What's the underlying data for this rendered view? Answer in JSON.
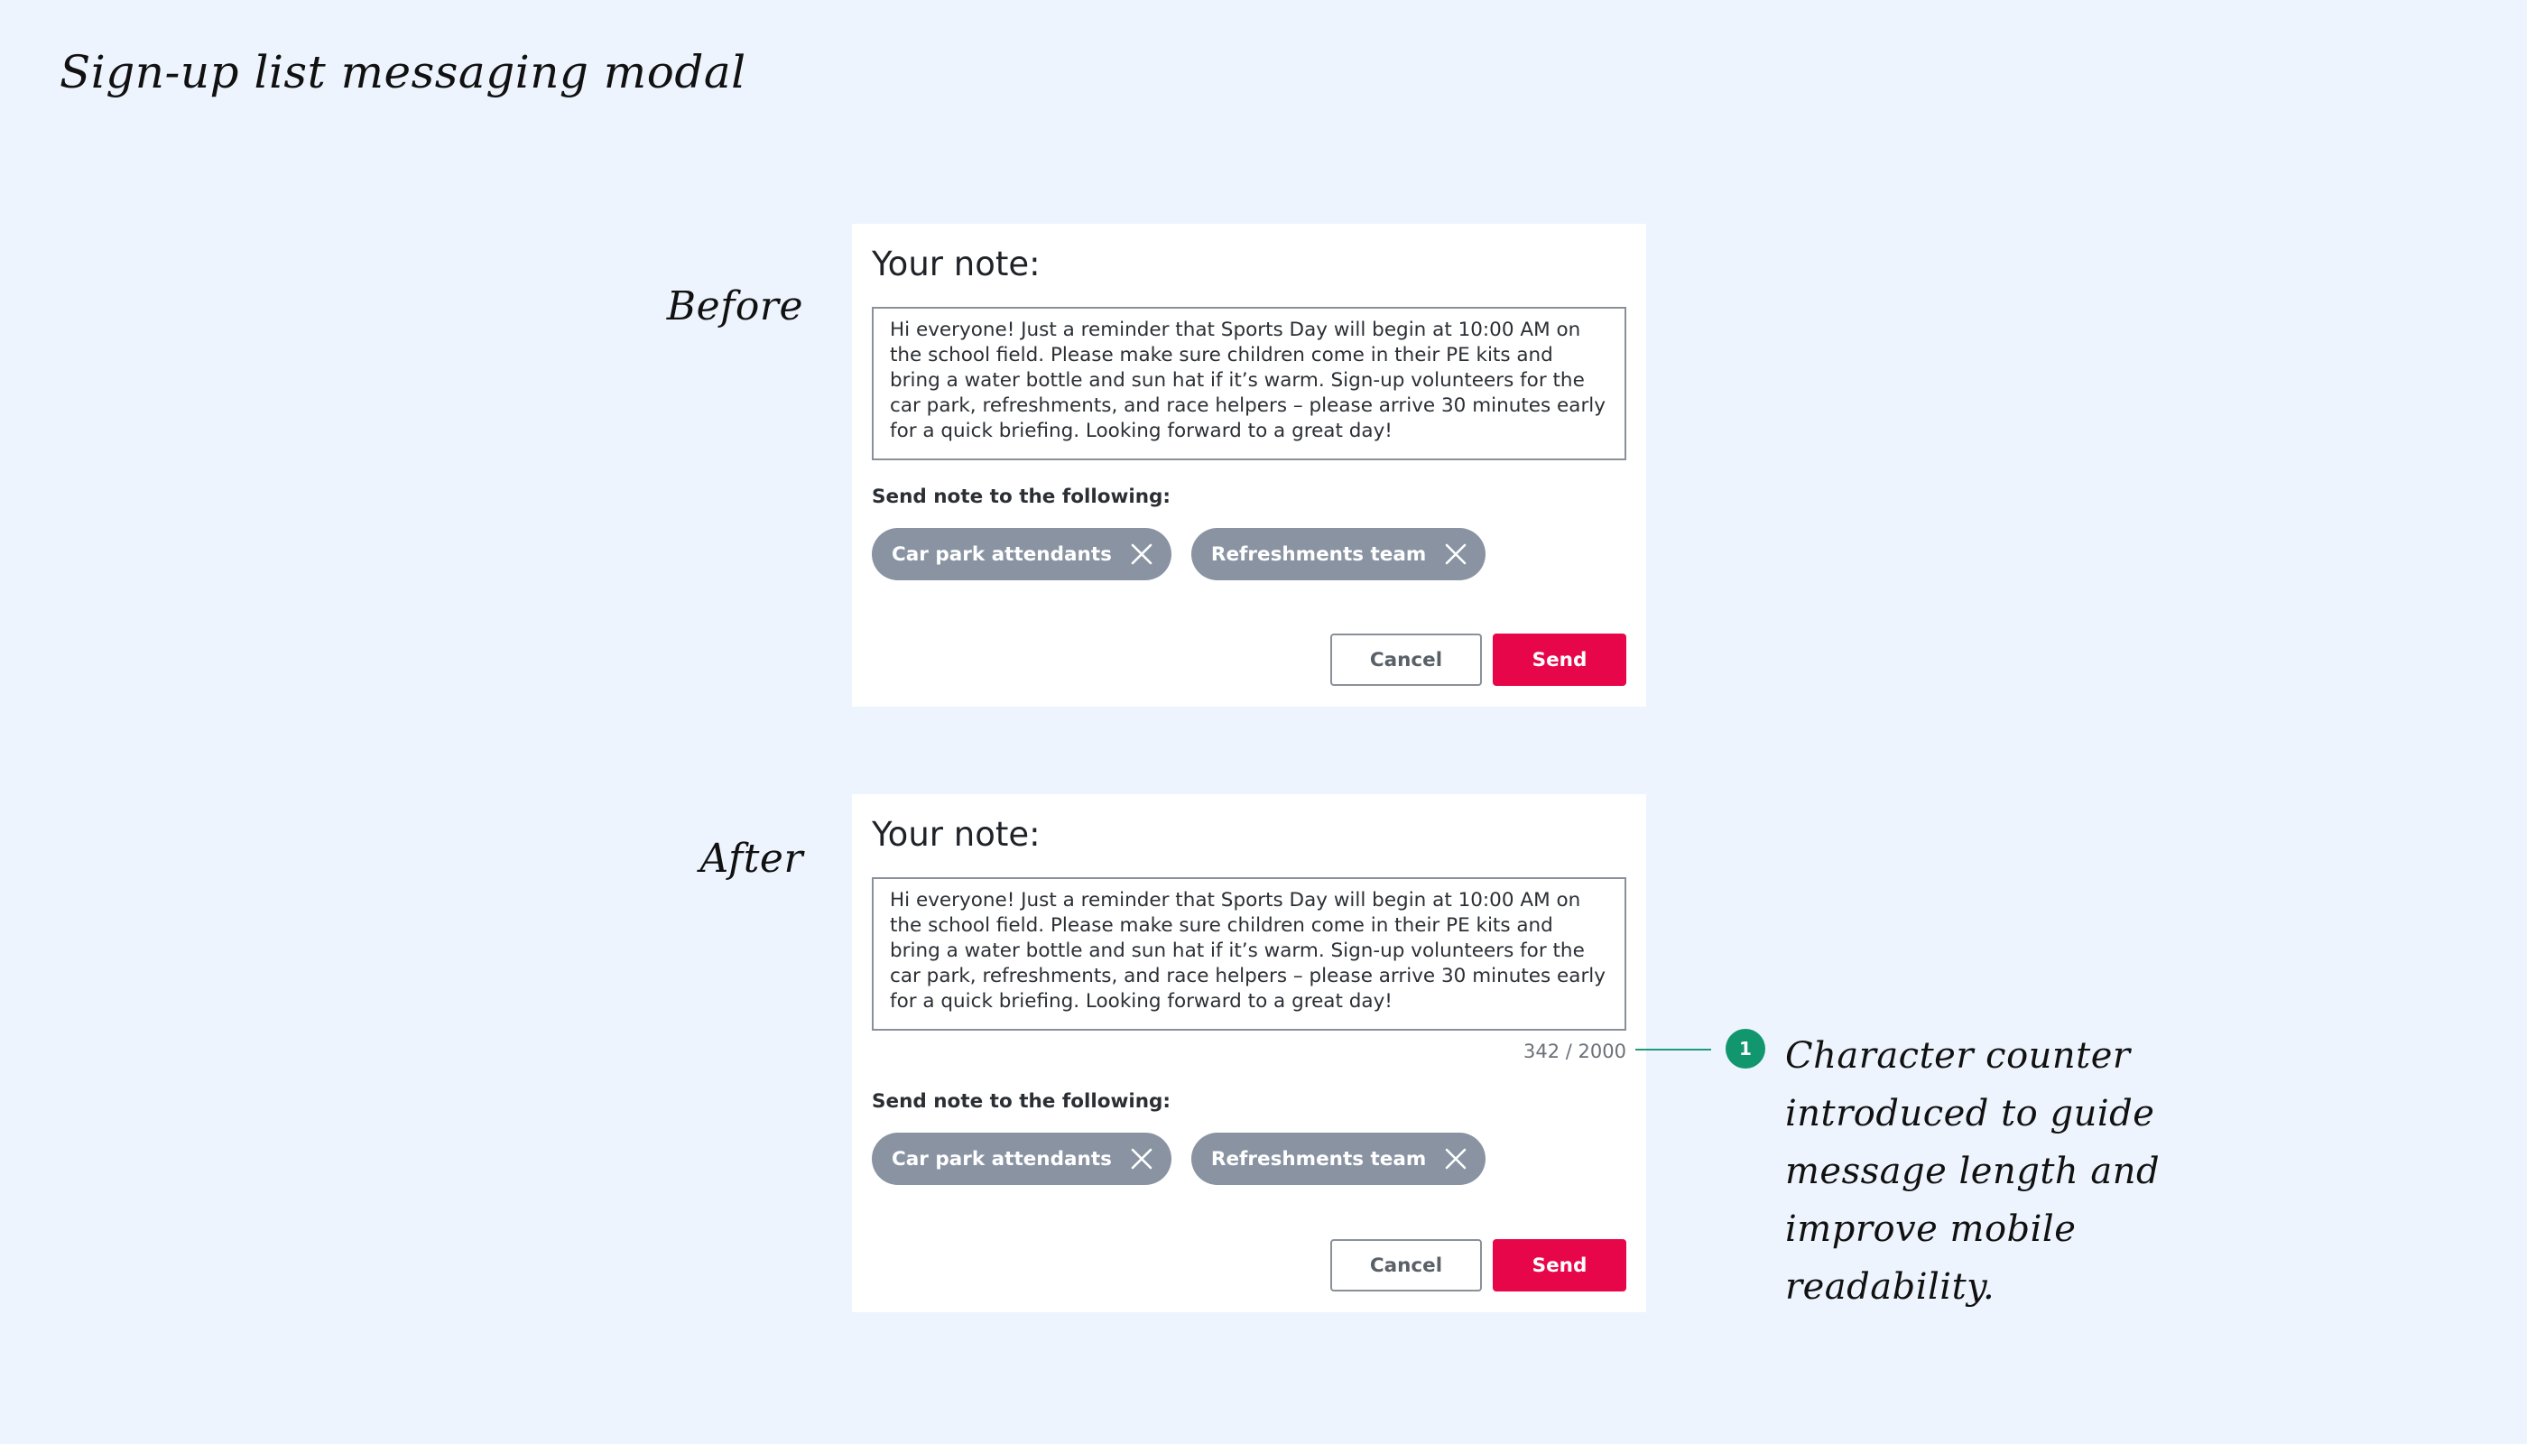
{
  "page": {
    "title": "Sign-up list messaging modal",
    "label_before": "Before",
    "label_after": "After"
  },
  "modal_before": {
    "title": "Your note:",
    "note_text": "Hi everyone! Just a reminder that Sports Day will begin at 10:00 AM on the school field. Please make sure children come in their PE kits and bring a water bottle and sun hat if it’s warm. Sign-up volunteers for the car park, refreshments, and race helpers – please arrive 30 minutes early for a quick briefing. Looking forward to a great day!",
    "send_label": "Send note to the following:",
    "chips": [
      {
        "label": "Car park attendants",
        "icon": "close-icon"
      },
      {
        "label": "Refreshments team",
        "icon": "close-icon"
      }
    ],
    "cancel_label": "Cancel",
    "send_button_label": "Send"
  },
  "modal_after": {
    "title": "Your note:",
    "note_text": "Hi everyone! Just a reminder that Sports Day will begin at 10:00 AM on the school field. Please make sure children come in their PE kits and bring a water bottle and sun hat if it’s warm. Sign-up volunteers for the car park, refreshments, and race helpers – please arrive 30 minutes early for a quick briefing. Looking forward to a great day!",
    "counter": "342 / 2000",
    "send_label": "Send note to the following:",
    "chips": [
      {
        "label": "Car park attendants",
        "icon": "close-icon"
      },
      {
        "label": "Refreshments team",
        "icon": "close-icon"
      }
    ],
    "cancel_label": "Cancel",
    "send_button_label": "Send"
  },
  "annotation": {
    "number": "1",
    "text": "Character counter introduced to guide message length and improve mobile readability."
  },
  "colors": {
    "background": "#edf4fd",
    "chip": "#8993a2",
    "send": "#e8064a",
    "annotation_accent": "#12966e"
  }
}
